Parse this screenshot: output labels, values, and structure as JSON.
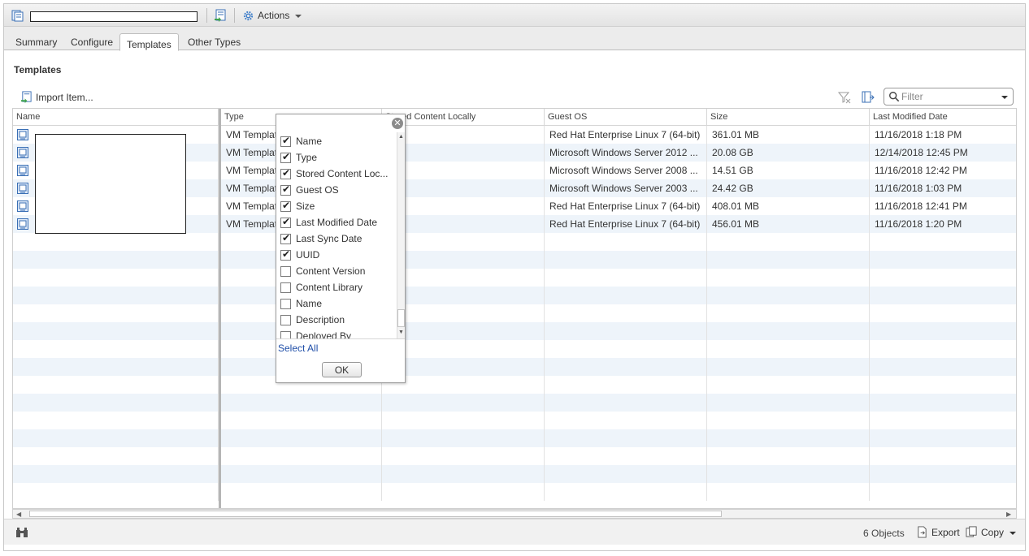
{
  "toolbar": {
    "actions_label": "Actions"
  },
  "tabs": [
    "Summary",
    "Configure",
    "Templates",
    "Other Types"
  ],
  "active_tab": "Templates",
  "section_title": "Templates",
  "import_label": "Import Item...",
  "filter": {
    "placeholder": "Filter"
  },
  "columns": [
    "Name",
    "Type",
    "Stored Content Locally",
    "Guest OS",
    "Size",
    "Last Modified Date"
  ],
  "rows": [
    {
      "type": "VM Templat",
      "guest_os": "Red Hat Enterprise Linux 7 (64-bit)",
      "size": "361.01  MB",
      "modified": "11/16/2018 1:18 PM"
    },
    {
      "type": "VM Templat",
      "guest_os": "Microsoft Windows Server 2012 ...",
      "size": "20.08  GB",
      "modified": "12/14/2018 12:45 PM"
    },
    {
      "type": "VM Templat",
      "guest_os": "Microsoft Windows Server 2008 ...",
      "size": "14.51  GB",
      "modified": "11/16/2018 12:42 PM"
    },
    {
      "type": "VM Templat",
      "guest_os": "Microsoft Windows Server 2003 ...",
      "size": "24.42  GB",
      "modified": "11/16/2018 1:03 PM"
    },
    {
      "type": "VM Templat",
      "guest_os": "Red Hat Enterprise Linux 7 (64-bit)",
      "size": "408.01  MB",
      "modified": "11/16/2018 12:41 PM"
    },
    {
      "type": "VM Templat",
      "guest_os": "Red Hat Enterprise Linux 7 (64-bit)",
      "size": "456.01  MB",
      "modified": "11/16/2018 1:20 PM"
    }
  ],
  "column_chooser": {
    "options": [
      {
        "label": "Name",
        "checked": true
      },
      {
        "label": "Type",
        "checked": true
      },
      {
        "label": "Stored Content Loc...",
        "checked": true
      },
      {
        "label": "Guest OS",
        "checked": true
      },
      {
        "label": "Size",
        "checked": true
      },
      {
        "label": "Last Modified Date",
        "checked": true
      },
      {
        "label": "Last Sync Date",
        "checked": true
      },
      {
        "label": "UUID",
        "checked": true
      },
      {
        "label": "Content Version",
        "checked": false
      },
      {
        "label": "Content Library",
        "checked": false
      },
      {
        "label": "Name",
        "checked": false
      },
      {
        "label": "Description",
        "checked": false
      },
      {
        "label": "Deployed By",
        "checked": false
      }
    ],
    "select_all_label": "Select All",
    "ok_label": "OK"
  },
  "footer": {
    "count_label": "6 Objects",
    "export_label": "Export",
    "copy_label": "Copy"
  },
  "icons": [
    "library-icon",
    "import-icon",
    "gear-icon",
    "vm-template-icon",
    "filter-clear-icon",
    "column-chooser-icon",
    "search-icon",
    "binoculars-icon",
    "export-icon",
    "copy-icon",
    "close-icon"
  ],
  "colors": {
    "row_alt": "#eef4fa",
    "link": "#1f4ea8",
    "accent": "#3a7bc8"
  }
}
